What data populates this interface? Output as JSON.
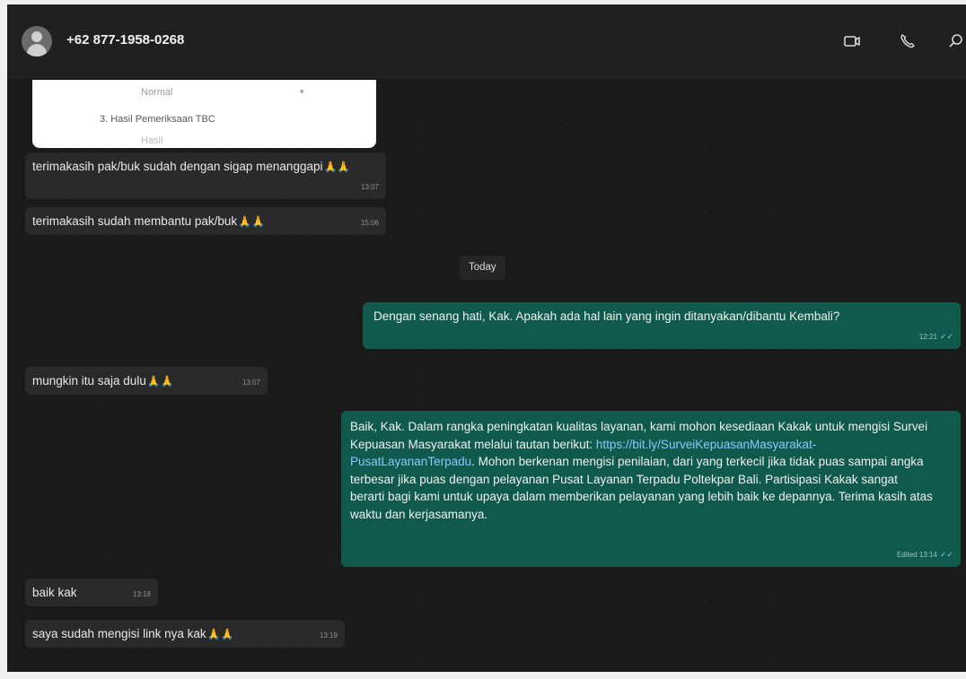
{
  "header": {
    "contact_name": "+62 877-1958-0268",
    "icons": [
      "video-call-icon",
      "voice-call-icon",
      "search-icon"
    ]
  },
  "form_preview": {
    "field1": "Normal",
    "field2": "3. Hasil Pemeriksaan TBC",
    "field3": "Hasil"
  },
  "messages": {
    "m1": {
      "text": "terimakasih pak/buk sudah dengan sigap menanggapi",
      "emoji": "🙏🙏",
      "time": "13:07"
    },
    "m2": {
      "text": "terimakasih sudah membantu pak/buk",
      "emoji": "🙏🙏",
      "time": "15:06"
    },
    "day": "Today",
    "m3": {
      "text": "Dengan senang hati, Kak. Apakah ada hal lain yang ingin ditanyakan/dibantu Kembali?",
      "time": "12:21"
    },
    "m4": {
      "text": "mungkin itu saja dulu",
      "emoji": "🙏🙏",
      "time": "13:07"
    },
    "m5": {
      "text_before": "Baik, Kak. Dalam rangka peningkatan kualitas layanan, kami mohon kesediaan Kakak untuk mengisi Survei Kepuasan Masyarakat melalui tautan berikut: ",
      "link": "https://bit.ly/SurveiKepuasanMasyarakat-PusatLayananTerpadu",
      "text_after": ". Mohon berkenan mengisi penilaian, dari yang terkecil jika tidak puas sampai angka terbesar jika puas dengan pelayanan Pusat Layanan Terpadu Poltekpar Bali. Partisipasi Kakak sangat berarti bagi kami untuk upaya dalam memberikan pelayanan yang lebih baik ke depannya. Terima kasih atas waktu dan kerjasamanya.",
      "time": "Edited 13:14"
    },
    "m6": {
      "text": "baik kak",
      "time": "13:18"
    },
    "m7": {
      "text": "saya sudah mengisi link nya kak",
      "emoji": "🙏🙏",
      "time": "13:19"
    }
  },
  "colors": {
    "background": "#1a1a1a",
    "incoming_bubble": "#2a2a2a",
    "outgoing_bubble": "#0f5a4d",
    "link": "#8fc6ff"
  }
}
